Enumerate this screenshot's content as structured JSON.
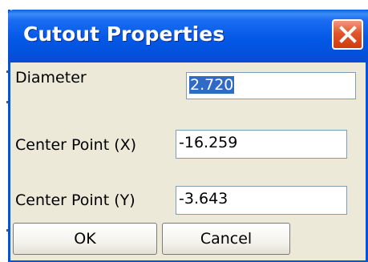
{
  "dialog": {
    "title": "Cutout Properties",
    "close_icon": "close-x-icon",
    "close_color": "#e0562c"
  },
  "fields": {
    "diameter": {
      "label": "Diameter",
      "value": "2.720"
    },
    "center_x": {
      "label": "Center Point (X)",
      "value": "-16.259"
    },
    "center_y": {
      "label": "Center Point (Y)",
      "value": "-3.643"
    }
  },
  "buttons": {
    "ok": "OK",
    "cancel": "Cancel"
  },
  "colors": {
    "titlebar": "#0358e6",
    "body": "#ece9d8",
    "selection": "#316ac5"
  }
}
